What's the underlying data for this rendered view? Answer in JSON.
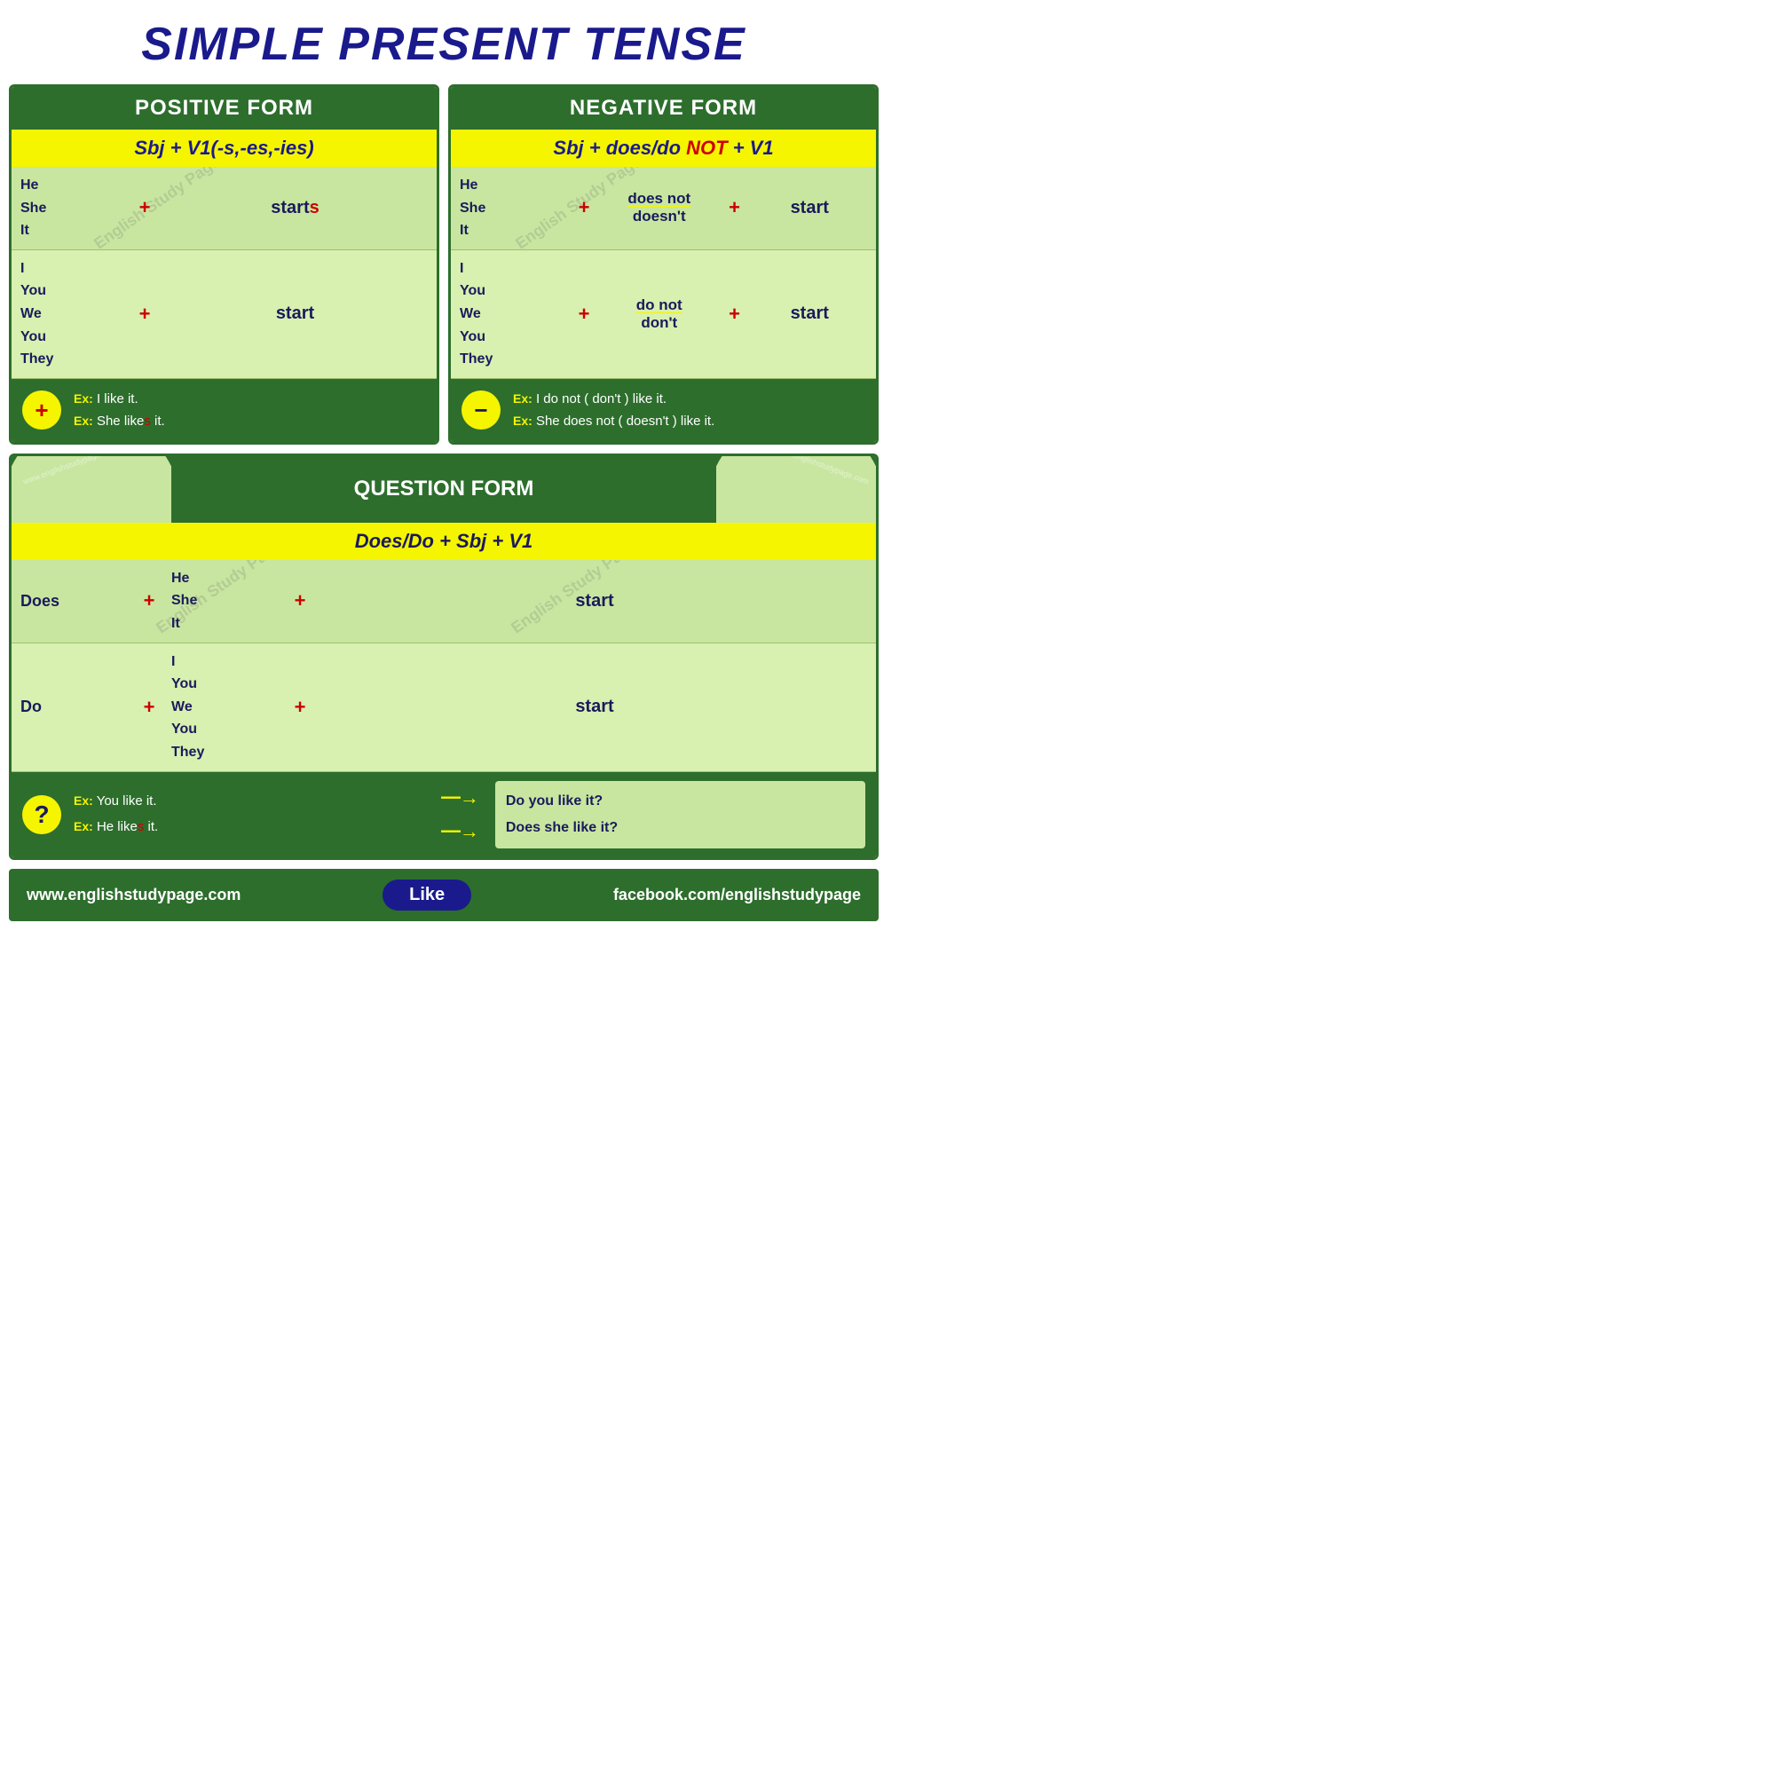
{
  "page": {
    "title": "SIMPLE PRESENT TENSE"
  },
  "positive": {
    "header": "POSITIVE FORM",
    "formula": "Sbj + V1(-s,-es,-ies)",
    "rows": [
      {
        "subjects": [
          "He",
          "She",
          "It"
        ],
        "plus": "+",
        "verb": "start",
        "verb_suffix": "s"
      },
      {
        "subjects": [
          "I",
          "You",
          "We",
          "You",
          "They"
        ],
        "plus": "+",
        "verb": "start",
        "verb_suffix": ""
      }
    ],
    "example_label1": "Ex:",
    "example1": "I like it.",
    "example_label2": "Ex:",
    "example2": "She like",
    "example2_s": "s",
    "example2_end": " it."
  },
  "negative": {
    "header": "NEGATIVE FORM",
    "formula_main": "Sbj + does/do ",
    "formula_red": "NOT",
    "formula_end": " + V1",
    "rows": [
      {
        "subjects": [
          "He",
          "She",
          "It"
        ],
        "plus": "+",
        "neg1": "does not",
        "neg2": "doesn't",
        "plus2": "+",
        "verb": "start"
      },
      {
        "subjects": [
          "I",
          "You",
          "We",
          "You",
          "They"
        ],
        "plus": "+",
        "neg1": "do not",
        "neg2": "don't",
        "plus2": "+",
        "verb": "start"
      }
    ],
    "example_label1": "Ex:",
    "example1": "I do not ( don't ) like it.",
    "example_label2": "Ex:",
    "example2": "She does not ( doesn't ) like it."
  },
  "question": {
    "header": "QUESTION FORM",
    "formula": "Does/Do +  Sbj + V1",
    "rows": [
      {
        "aux": "Does",
        "plus": "+",
        "subjects": [
          "He",
          "She",
          "It"
        ],
        "plus2": "+",
        "verb": "start"
      },
      {
        "aux": "Do",
        "plus": "+",
        "subjects": [
          "I",
          "You",
          "We",
          "You",
          "They"
        ],
        "plus2": "+",
        "verb": "start"
      }
    ],
    "example_label1": "Ex:",
    "example1": "You like it.",
    "example_label2": "Ex:",
    "example2": "He like",
    "example2_s": "s",
    "example2_end": " it.",
    "arrow": "-->",
    "result1": "Do you like it?",
    "result2": "Does she like it?",
    "watermark": "English Study Page"
  },
  "footer": {
    "left": "www.englishstudypage.com",
    "like": "Like",
    "right": "facebook.com/englishstudypage"
  }
}
